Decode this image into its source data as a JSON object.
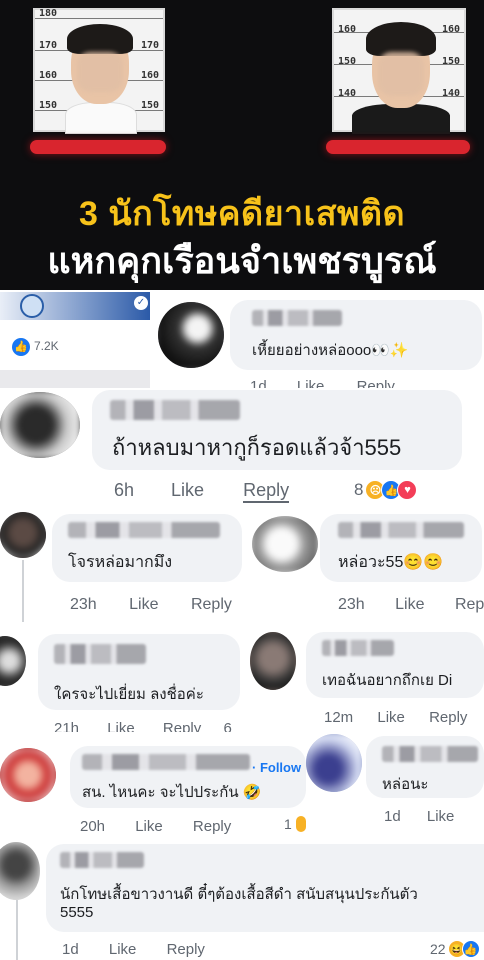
{
  "banner": {
    "headline_line1": "3 นักโทษคดียาเสพติด",
    "headline_line2": "แหกคุกเรือนจำเพชรบูรณ์",
    "left_board_marks": [
      "180",
      "170",
      "170",
      "160",
      "160",
      "150",
      "150"
    ],
    "right_board_marks": [
      "160",
      "160",
      "150",
      "150",
      "140",
      "140"
    ]
  },
  "post": {
    "like_count": "7.2K"
  },
  "comments": [
    {
      "id": "c1",
      "text": "เหี้ยยอย่างหล่อooo👀✨",
      "time": "1d",
      "like": "Like",
      "reply": "Reply"
    },
    {
      "id": "c2",
      "text": "ถ้าหลบมาหากูก็รอดแล้วจ้า555",
      "time": "6h",
      "like": "Like",
      "reply": "Reply",
      "reactions": "8"
    },
    {
      "id": "c3",
      "text": "โจรหล่อมากมึง",
      "time": "23h",
      "like": "Like",
      "reply": "Reply"
    },
    {
      "id": "c4",
      "text": "หล่อวะ55😊😊",
      "time": "23h",
      "like": "Like",
      "reply": "Rep"
    },
    {
      "id": "c5",
      "text": "ใครจะไปเยี่ยม ลงชื่อค่ะ",
      "time": "21h",
      "like": "Like",
      "reply": "Reply",
      "extra": "6"
    },
    {
      "id": "c6",
      "text": "เทอฉันอยากถึกเย Di",
      "time": "12m",
      "like": "Like",
      "reply": "Reply"
    },
    {
      "id": "c7",
      "text": "สน. ไหนคะ จะไปประกัน 🤣",
      "time": "20h",
      "like": "Like",
      "reply": "Reply",
      "reactions": "1",
      "follow": "· Follow"
    },
    {
      "id": "c8",
      "text": "หล่อนะ",
      "time": "1d",
      "like": "Like"
    },
    {
      "id": "c9",
      "text_line1": "นักโทษเสื้อขาวงานดี ตี๋ๆต้องเสื้อสีดำ สนับสนุนประกันตัว",
      "text_line2": "5555",
      "time": "1d",
      "like": "Like",
      "reply": "Reply",
      "reactions": "22"
    }
  ],
  "colors": {
    "headline_yellow": "#f7c21a",
    "accent_red": "#d9252e",
    "fb_blue": "#1877f2",
    "bubble_gray": "#f0f2f5"
  }
}
